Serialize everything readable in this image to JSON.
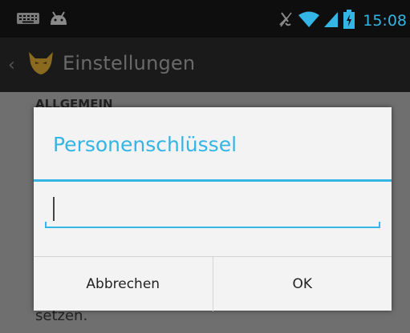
{
  "status_bar": {
    "time": "15:08",
    "icons": [
      "keyboard-icon",
      "android-icon",
      "mute-icon",
      "wifi-icon",
      "signal-icon",
      "battery-charging-icon"
    ]
  },
  "action_bar": {
    "title": "Einstellungen",
    "icon": "fox-app-icon"
  },
  "background": {
    "section_header": "ALLGEMEIN",
    "partial_text": "setzen."
  },
  "dialog": {
    "title": "Personenschlüssel",
    "input_value": "",
    "cancel_label": "Abbrechen",
    "ok_label": "OK"
  },
  "colors": {
    "accent": "#33b5e5",
    "status_bar": "#0e0e0e",
    "dialog_bg": "#f3f3f3"
  }
}
